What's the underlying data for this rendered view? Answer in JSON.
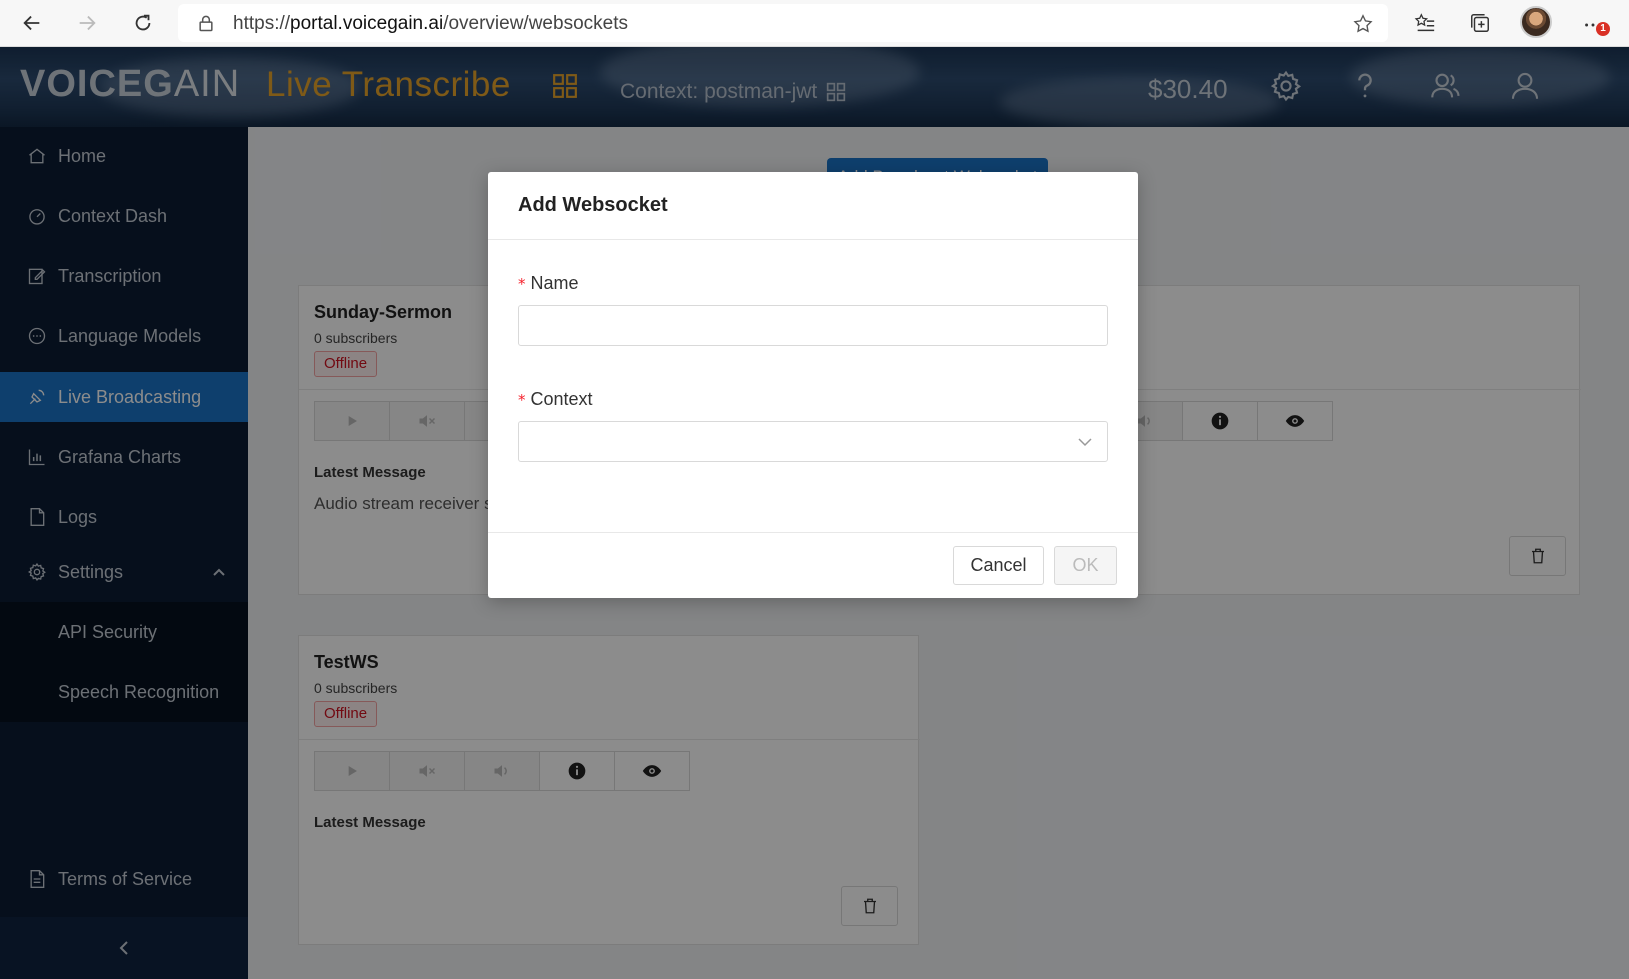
{
  "browser": {
    "url_scheme": "https://",
    "url_host": "portal.voicegain.ai",
    "url_path": "/overview/websockets",
    "notification_count": "1"
  },
  "header": {
    "logo_voice": "VOICEG",
    "logo_gain": "AIN",
    "product": "Live Transcribe",
    "context_prefix": "Context:",
    "context_name": "postman-jwt",
    "balance": "$30.40",
    "accent_color": "#e8a52a"
  },
  "sidebar": {
    "items": [
      {
        "label": "Home",
        "icon": "home-icon"
      },
      {
        "label": "Context Dash",
        "icon": "dashboard-icon"
      },
      {
        "label": "Transcription",
        "icon": "edit-icon"
      },
      {
        "label": "Language Models",
        "icon": "message-icon"
      },
      {
        "label": "Live Broadcasting",
        "icon": "broadcast-icon",
        "active": true
      },
      {
        "label": "Grafana Charts",
        "icon": "bar-chart-icon"
      },
      {
        "label": "Logs",
        "icon": "file-icon"
      },
      {
        "label": "Settings",
        "icon": "gear-icon",
        "expanded": true
      }
    ],
    "subitems": [
      {
        "label": "API Security"
      },
      {
        "label": "Speech Recognition"
      }
    ],
    "footer": {
      "label": "Terms of Service",
      "icon": "document-icon"
    },
    "active_color": "#1a73c7"
  },
  "main": {
    "add_button_label": "Add Broadcast Websocket",
    "cards": [
      {
        "title": "Sunday-Sermon",
        "subscribers": "0 subscribers",
        "status": "Offline",
        "latest_label": "Latest Message",
        "latest_message": "Audio stream receiver s"
      },
      {
        "title": "TestWS",
        "subscribers": "0 subscribers",
        "status": "Offline",
        "latest_label": "Latest Message",
        "latest_message": ""
      }
    ]
  },
  "modal": {
    "title": "Add Websocket",
    "name_label": "Name",
    "name_value": "",
    "context_label": "Context",
    "context_value": "",
    "required_mark": "*",
    "cancel_label": "Cancel",
    "ok_label": "OK"
  }
}
